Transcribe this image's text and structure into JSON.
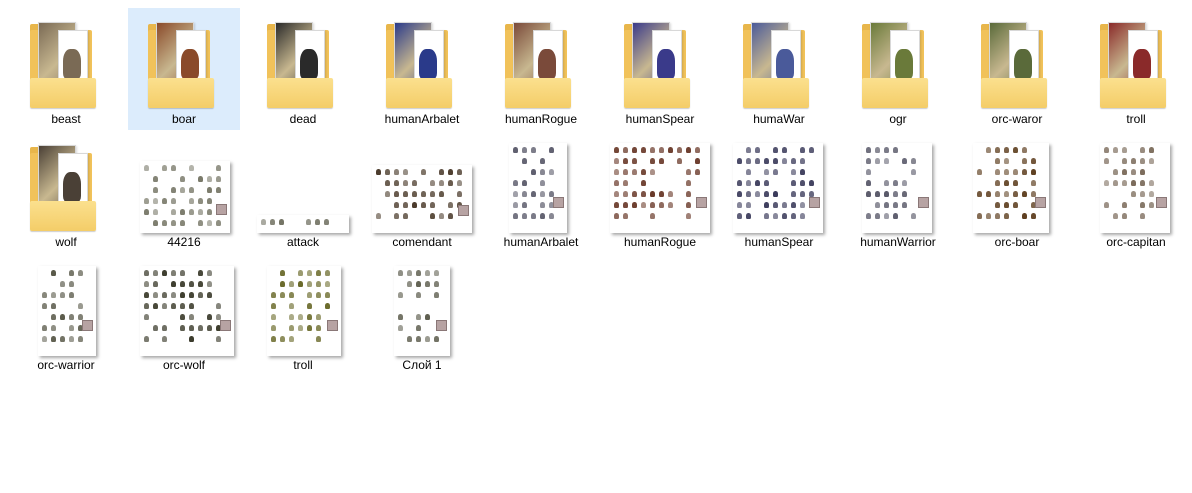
{
  "items": [
    {
      "label": "beast",
      "kind": "folder",
      "selected": false,
      "color": "#7a6a55"
    },
    {
      "label": "boar",
      "kind": "folder",
      "selected": true,
      "color": "#8a4a2a"
    },
    {
      "label": "dead",
      "kind": "folder",
      "selected": false,
      "color": "#2a2a2a"
    },
    {
      "label": "humanArbalet",
      "kind": "folder",
      "selected": false,
      "color": "#2a3a8a"
    },
    {
      "label": "humanRogue",
      "kind": "folder",
      "selected": false,
      "color": "#7a4a3a"
    },
    {
      "label": "humanSpear",
      "kind": "folder",
      "selected": false,
      "color": "#3a3a8a"
    },
    {
      "label": "humaWar",
      "kind": "folder",
      "selected": false,
      "color": "#4a5a9a"
    },
    {
      "label": "ogr",
      "kind": "folder",
      "selected": false,
      "color": "#6a7a3a"
    },
    {
      "label": "orc-waror",
      "kind": "folder",
      "selected": false,
      "color": "#5a6a3a"
    },
    {
      "label": "troll",
      "kind": "folder",
      "selected": false,
      "color": "#8a2a2a"
    },
    {
      "label": "wolf",
      "kind": "folder",
      "selected": false,
      "color": "#4a4036"
    },
    {
      "label": "44216",
      "kind": "image",
      "selected": false,
      "color": "#7a7a6a"
    },
    {
      "label": "attack",
      "kind": "image",
      "selected": false,
      "color": "#6a6a5a"
    },
    {
      "label": "comendant",
      "kind": "image",
      "selected": false,
      "color": "#4a3a2a"
    },
    {
      "label": "humanArbalet",
      "kind": "image",
      "selected": false,
      "color": "#5a5a6a"
    },
    {
      "label": "humanRogue",
      "kind": "image",
      "selected": false,
      "color": "#6a3a2a"
    },
    {
      "label": "humanSpear",
      "kind": "image",
      "selected": false,
      "color": "#3a3a5a"
    },
    {
      "label": "humanWarrior",
      "kind": "image",
      "selected": false,
      "color": "#5a5a6a"
    },
    {
      "label": "orc-boar",
      "kind": "image",
      "selected": false,
      "color": "#5a3a1a"
    },
    {
      "label": "orc-capitan",
      "kind": "image",
      "selected": false,
      "color": "#7a6a5a"
    },
    {
      "label": "orc-warrior",
      "kind": "image",
      "selected": false,
      "color": "#5a5a4a"
    },
    {
      "label": "orc-wolf",
      "kind": "image",
      "selected": false,
      "color": "#3a3a2a"
    },
    {
      "label": "troll",
      "kind": "image",
      "selected": false,
      "color": "#6a6a2a"
    },
    {
      "label": "Слой 1",
      "kind": "image",
      "selected": false,
      "color": "#5a5a4a"
    }
  ]
}
